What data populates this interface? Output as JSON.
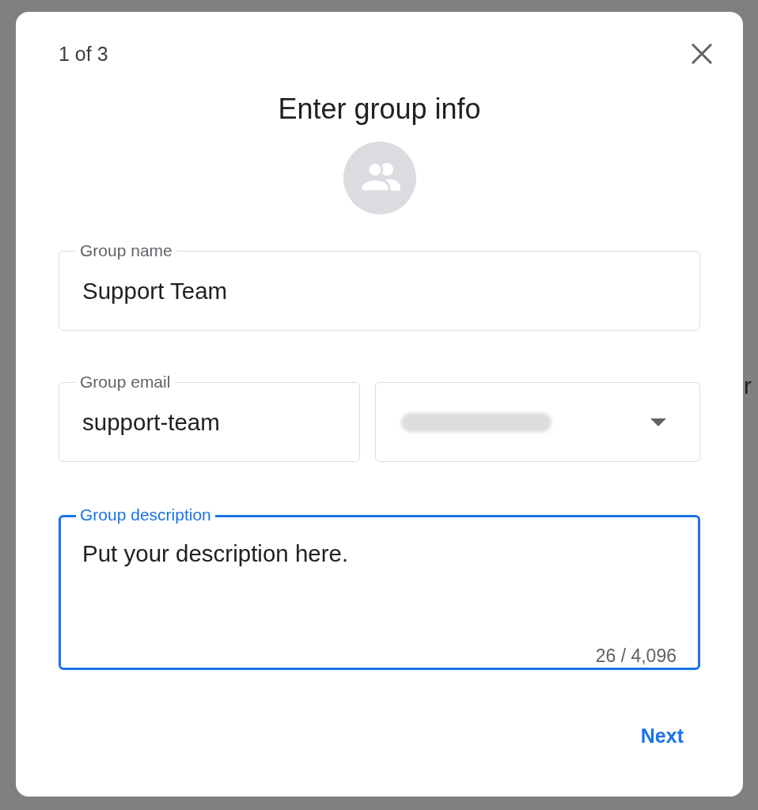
{
  "background": {
    "text": "r"
  },
  "dialog": {
    "step": "1 of 3",
    "title": "Enter group info"
  },
  "fields": [
    {
      "kind": "text",
      "label": "Group name",
      "value": "Support Team",
      "focused": false
    },
    {
      "kind": "email",
      "label": "Group email",
      "value": "support-team",
      "focused": false
    },
    {
      "kind": "textarea",
      "label": "Group description",
      "value": "Put your description here.",
      "counter": "26 / 4,096",
      "focused": true
    }
  ],
  "buttons": [
    {
      "label": "Next"
    }
  ]
}
